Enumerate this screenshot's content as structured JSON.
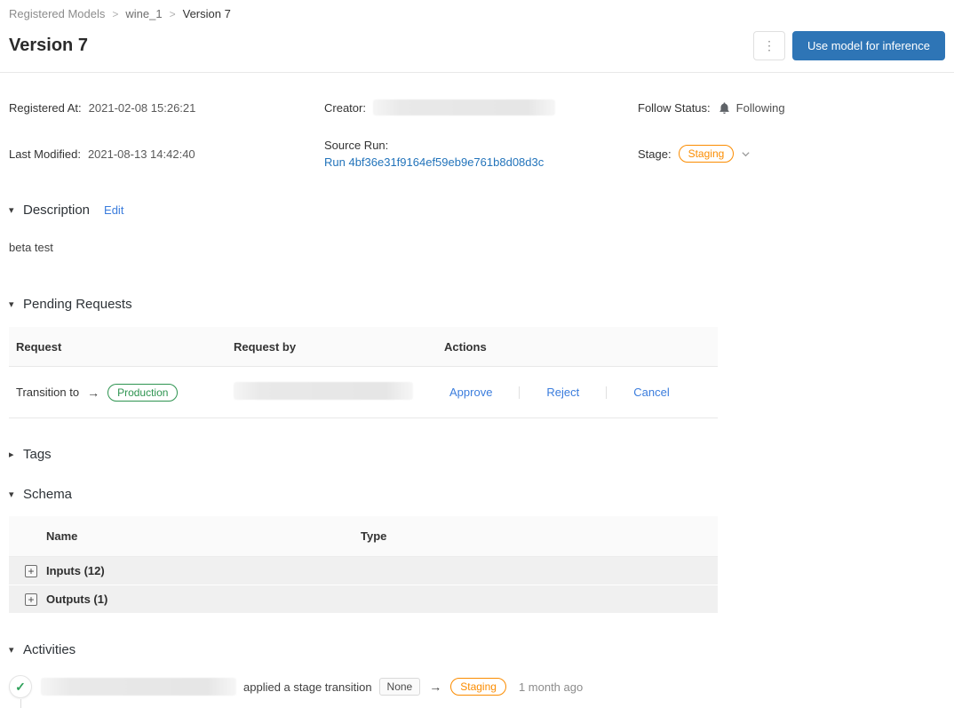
{
  "breadcrumb": {
    "items": [
      "Registered Models",
      "wine_1",
      "Version 7"
    ],
    "separator": ">"
  },
  "header": {
    "title": "Version 7",
    "overflow_button_glyph": "⋮",
    "primary_button_label": "Use model for inference"
  },
  "metadata": {
    "registered_at_label": "Registered At:",
    "registered_at_value": "2021-02-08 15:26:21",
    "last_modified_label": "Last Modified:",
    "last_modified_value": "2021-08-13 14:42:40",
    "creator_label": "Creator:",
    "source_run_label": "Source Run:",
    "source_run_link": "Run 4bf36e31f9164ef59eb9e761b8d08d3c",
    "follow_status_label": "Follow Status:",
    "follow_status_value": "Following",
    "stage_label": "Stage:",
    "stage_value": "Staging"
  },
  "glyphs": {
    "caret_down": "▾",
    "caret_right": "▸",
    "arrow_right": "→",
    "check": "✓",
    "plus": "+"
  },
  "sections": {
    "description": {
      "title": "Description",
      "edit_label": "Edit",
      "content": "beta test"
    },
    "pending_requests": {
      "title": "Pending Requests",
      "columns": [
        "Request",
        "Request by",
        "Actions"
      ],
      "row": {
        "request_text": "Transition to",
        "target_stage": "Production",
        "actions": [
          "Approve",
          "Reject",
          "Cancel"
        ]
      }
    },
    "tags": {
      "title": "Tags"
    },
    "schema": {
      "title": "Schema",
      "columns": [
        "Name",
        "Type"
      ],
      "rows": [
        {
          "name": "Inputs (12)"
        },
        {
          "name": "Outputs (1)"
        }
      ]
    },
    "activities": {
      "title": "Activities",
      "items": [
        {
          "action_text": "applied a stage transition",
          "from_stage": "None",
          "to_stage": "Staging",
          "timestamp": "1 month ago"
        }
      ]
    }
  },
  "colors": {
    "primary_button_blue": "#2E75B6",
    "link_blue": "#3B7DDD",
    "run_link_blue": "#2374BB",
    "stage_orange": "#FB8C00",
    "production_green": "#2E9450",
    "check_green": "#2FA25B"
  }
}
